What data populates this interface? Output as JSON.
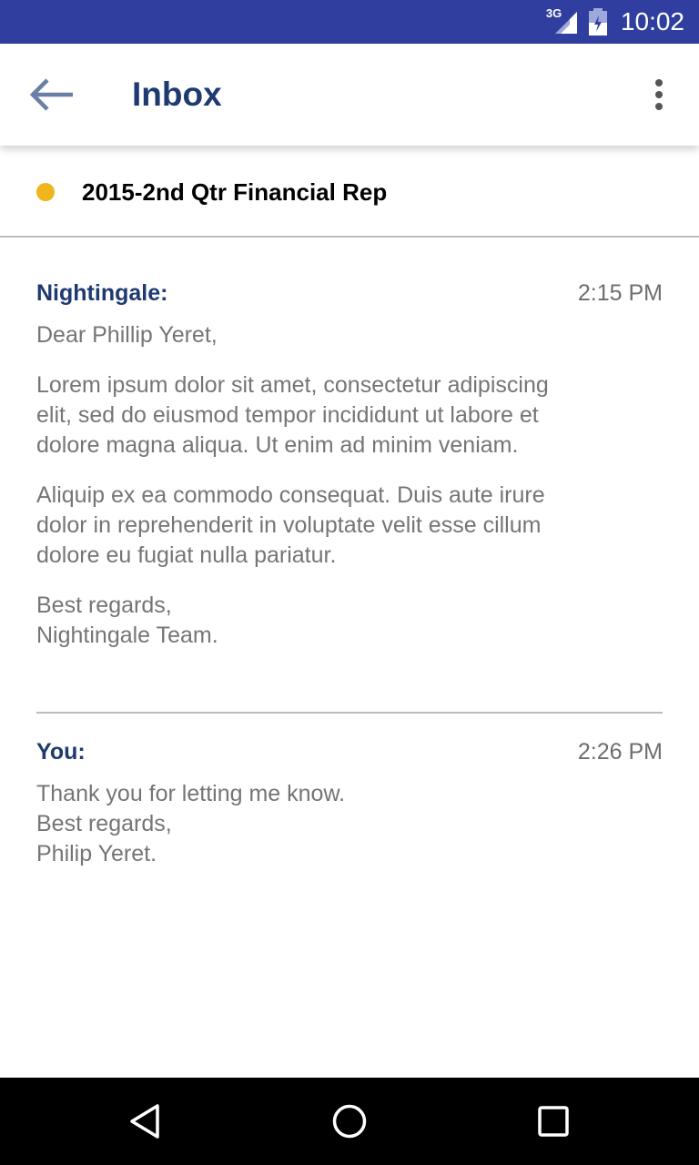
{
  "status_bar": {
    "network_label": "3G",
    "time": "10:02",
    "icons": [
      "signal-icon",
      "battery-icon"
    ]
  },
  "app_bar": {
    "title": "Inbox",
    "back_icon": "arrow-left-icon",
    "menu_icon": "more-vert-icon"
  },
  "thread": {
    "subject": "2015-2nd Qtr Financial Rep",
    "unread_color": "#f0b41c"
  },
  "messages": [
    {
      "sender": "Nightingale:",
      "time": "2:15 PM",
      "greeting": "Dear Phillip Yeret,",
      "paragraphs": [
        "Lorem ipsum dolor sit amet, consectetur adipiscing\nelit, sed do eiusmod tempor incididunt ut labore et\ndolore magna aliqua. Ut enim ad minim veniam.",
        "Aliquip ex ea commodo consequat. Duis aute irure\ndolor in reprehenderit in voluptate velit esse cillum\ndolore eu fugiat nulla pariatur.",
        "Best regards,\nNightingale Team."
      ]
    },
    {
      "sender": "You:",
      "time": "2:26 PM",
      "body": "Thank you for letting me know.\nBest regards,\nPhilip Yeret."
    }
  ],
  "nav_bar": {
    "icons": [
      "nav-back-icon",
      "nav-home-icon",
      "nav-recents-icon"
    ]
  },
  "colors": {
    "status_bar": "#303f9f",
    "title": "#1e3a70",
    "body_text": "#757575",
    "divider": "#bdbdbd"
  }
}
